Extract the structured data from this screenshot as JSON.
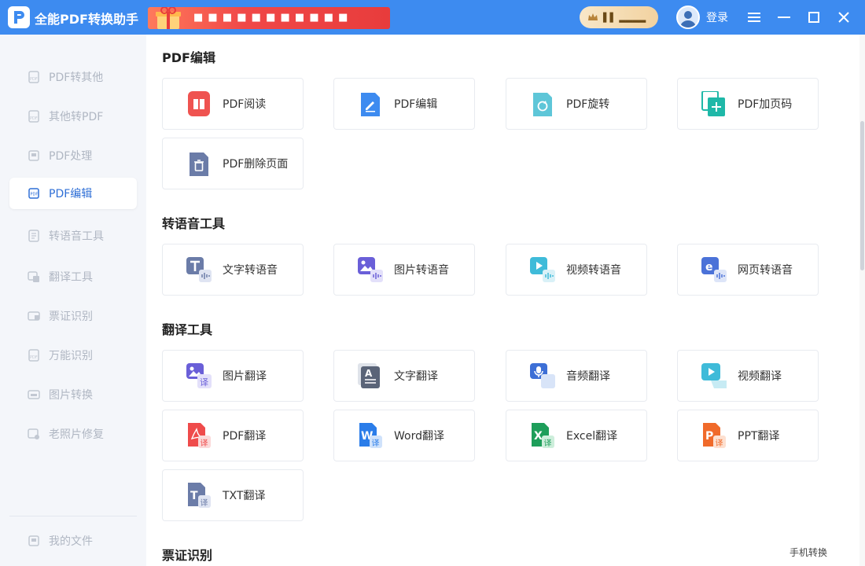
{
  "app": {
    "title": "全能PDF转换助手",
    "promo_text": "■ ■ ■ ■ ■ ■ ■ ■ ■ ■ ■",
    "vip_text": "▌▌ ▂▂▂▂",
    "login": "登录"
  },
  "sidebar": {
    "items": [
      {
        "label": "PDF转其他",
        "icon": "pdf-convert-icon"
      },
      {
        "label": "其他转PDF",
        "icon": "to-pdf-icon"
      },
      {
        "label": "PDF处理",
        "icon": "pdf-process-icon"
      },
      {
        "label": "PDF编辑",
        "icon": "pdf-edit-icon",
        "active": true
      },
      {
        "label": "转语音工具",
        "icon": "speech-icon"
      },
      {
        "label": "翻译工具",
        "icon": "translate-icon"
      },
      {
        "label": "票证识别",
        "icon": "ticket-icon"
      },
      {
        "label": "万能识别",
        "icon": "ocr-icon"
      },
      {
        "label": "图片转换",
        "icon": "image-convert-icon"
      },
      {
        "label": "老照片修复",
        "icon": "photo-repair-icon"
      }
    ],
    "my_files": "我的文件"
  },
  "sections": {
    "pdf_edit": {
      "title": "PDF编辑",
      "cards": [
        "PDF阅读",
        "PDF编辑",
        "PDF旋转",
        "PDF加页码",
        "PDF删除页面"
      ]
    },
    "speech": {
      "title": "转语音工具",
      "cards": [
        "文字转语音",
        "图片转语音",
        "视频转语音",
        "网页转语音"
      ]
    },
    "translate": {
      "title": "翻译工具",
      "cards": [
        "图片翻译",
        "文字翻译",
        "音频翻译",
        "视频翻译",
        "PDF翻译",
        "Word翻译",
        "Excel翻译",
        "PPT翻译",
        "TXT翻译"
      ]
    },
    "ticket": {
      "title": "票证识别",
      "mobile_link": "手机转换"
    }
  },
  "colors": {
    "titlebar": "#3d8bf0",
    "accent": "#2f6fd6"
  }
}
